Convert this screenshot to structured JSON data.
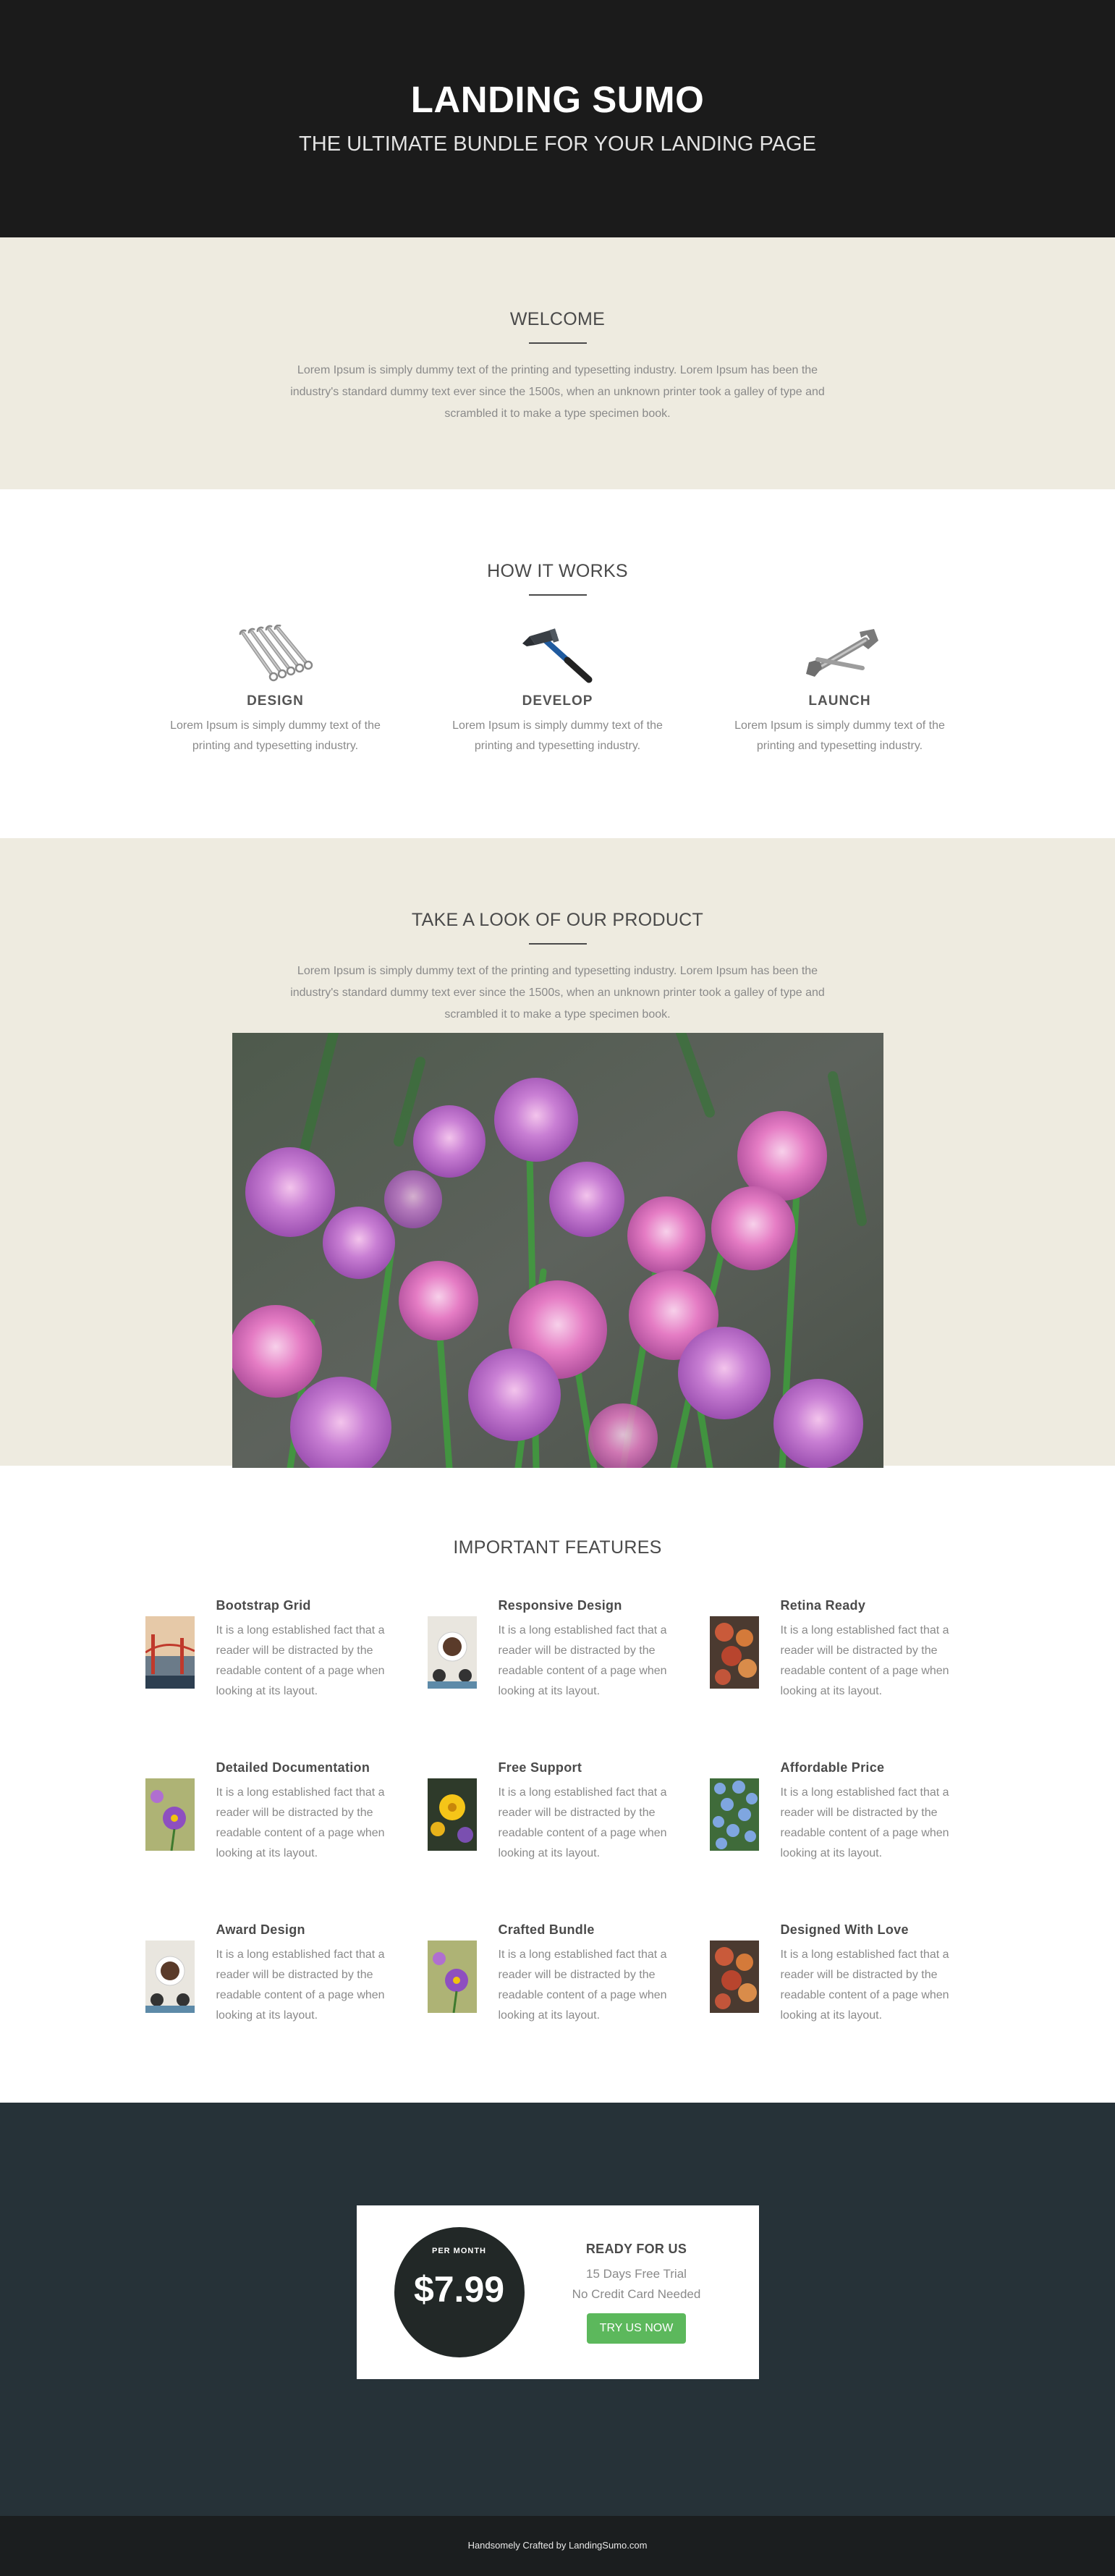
{
  "hero": {
    "title": "LANDING SUMO",
    "subtitle": "THE ULTIMATE BUNDLE FOR YOUR LANDING PAGE"
  },
  "welcome": {
    "title": "WELCOME",
    "text": "Lorem Ipsum is simply dummy text of the printing and typesetting industry. Lorem Ipsum has been the industry's standard dummy text ever since the 1500s, when an unknown printer took a galley of type and scrambled it to make a type specimen book."
  },
  "how": {
    "title": "HOW IT WORKS",
    "steps": [
      {
        "label": "DESIGN",
        "icon": "wrench-set-icon",
        "text": "Lorem Ipsum is simply dummy text of the printing and typesetting industry."
      },
      {
        "label": "DEVELOP",
        "icon": "hammer-icon",
        "text": "Lorem Ipsum is simply dummy text of the printing and typesetting industry."
      },
      {
        "label": "LAUNCH",
        "icon": "adjustable-wrench-icon",
        "text": "Lorem Ipsum is simply dummy text of the printing and typesetting industry."
      }
    ]
  },
  "product": {
    "title": "TAKE A LOOK OF OUR PRODUCT",
    "text": "Lorem Ipsum is simply dummy text of the printing and typesetting industry. Lorem Ipsum has been the industry's standard dummy text ever since the 1500s, when an unknown printer took a galley of type and scrambled it to make a type specimen book."
  },
  "features": {
    "title": "IMPORTANT FEATURES",
    "items": [
      {
        "title": "Bootstrap Grid",
        "text": "It is a long established fact that a reader will be distracted by the readable content of a page when looking at its layout."
      },
      {
        "title": "Responsive Design",
        "text": "It is a long established fact that a reader will be distracted by the readable content of a page when looking at its layout."
      },
      {
        "title": "Retina Ready",
        "text": "It is a long established fact that a reader will be distracted by the readable content of a page when looking at its layout."
      },
      {
        "title": "Detailed Documentation",
        "text": "It is a long established fact that a reader will be distracted by the readable content of a page when looking at its layout."
      },
      {
        "title": "Free Support",
        "text": "It is a long established fact that a reader will be distracted by the readable content of a page when looking at its layout."
      },
      {
        "title": "Affordable Price",
        "text": "It is a long established fact that a reader will be distracted by the readable content of a page when looking at its layout."
      },
      {
        "title": "Award Design",
        "text": "It is a long established fact that a reader will be distracted by the readable content of a page when looking at its layout."
      },
      {
        "title": "Crafted Bundle",
        "text": "It is a long established fact that a reader will be distracted by the readable content of a page when looking at its layout."
      },
      {
        "title": "Designed With Love",
        "text": "It is a long established fact that a reader will be distracted by the readable content of a page when looking at its layout."
      }
    ]
  },
  "pricing": {
    "per_month": "PER MONTH",
    "price": "$7.99",
    "ready": "READY FOR US",
    "trial": "15 Days Free Trial",
    "no_card": "No Credit Card Needed",
    "button": "TRY US NOW"
  },
  "footer": {
    "text": "Handsomely Crafted by LandingSumo.com"
  },
  "colors": {
    "hero_bg": "#1b1b1b",
    "beige_bg": "#eeebe0",
    "pricing_bg": "#263238",
    "footer_bg": "#1b1e1f",
    "button_green": "#5cb85c",
    "price_circle": "#222827"
  }
}
